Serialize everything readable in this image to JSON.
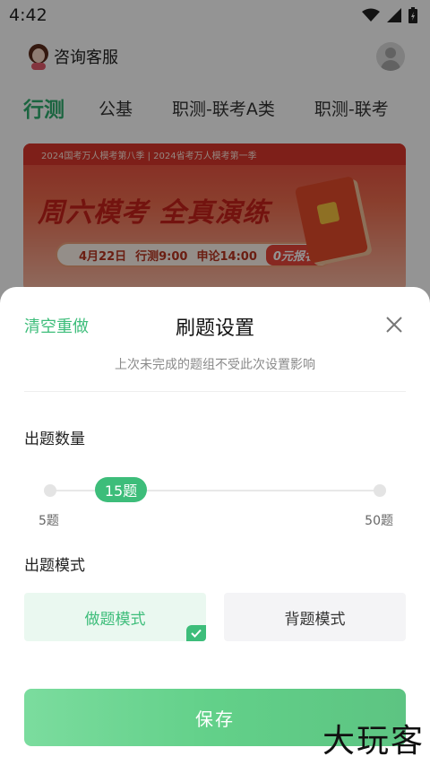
{
  "status_bar": {
    "time": "4:42"
  },
  "header": {
    "service_label": "咨询客服"
  },
  "tabs": [
    {
      "label": "行测",
      "active": true
    },
    {
      "label": "公基"
    },
    {
      "label": "职测-联考A类"
    },
    {
      "label": "职测-联考"
    }
  ],
  "banner": {
    "ribbon": "2024国考万人模考第八季 | 2024省考万人模考第一季",
    "headline": "周六模考 全真演练",
    "date": "4月22日",
    "schedule_1": "行测9:00",
    "schedule_2": "申论14:00",
    "tag": "0元报名"
  },
  "sheet": {
    "clear_label": "清空重做",
    "title": "刷题设置",
    "subtitle": "上次未完成的题组不受此次设置影响",
    "count_label": "出题数量",
    "slider": {
      "value_label": "15题",
      "min_label": "5题",
      "max_label": "50题",
      "value": 15,
      "min": 5,
      "max": 50
    },
    "mode_label": "出题模式",
    "modes": [
      {
        "label": "做题模式",
        "selected": true
      },
      {
        "label": "背题模式",
        "selected": false
      }
    ],
    "save_label": "保存"
  },
  "watermark": "大玩客",
  "colors": {
    "accent": "#3dbd7a",
    "accent_light": "#eaf8f0"
  }
}
